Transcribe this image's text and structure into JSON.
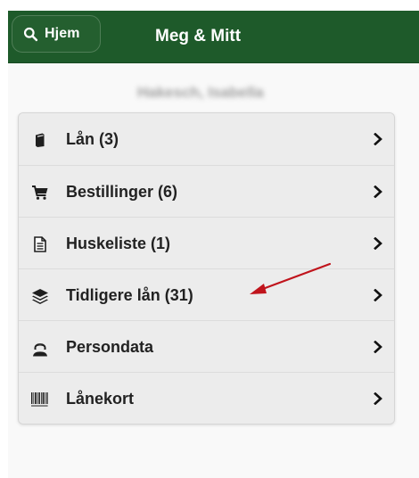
{
  "colors": {
    "header_bg": "#1e5a2a",
    "menu_bg": "#ececec",
    "annotation_arrow": "#c0141c"
  },
  "header": {
    "home_button_label": "Hjem",
    "home_button_icon": "search-icon",
    "title": "Meg & Mitt"
  },
  "patron": {
    "name": "Hakesch, Isabella"
  },
  "menu": {
    "items": [
      {
        "label": "Lån (3)",
        "icon": "book-icon"
      },
      {
        "label": "Bestillinger (6)",
        "icon": "cart-icon"
      },
      {
        "label": "Huskeliste (1)",
        "icon": "document-icon"
      },
      {
        "label": "Tidligere lån (31)",
        "icon": "layers-icon"
      },
      {
        "label": "Persondata",
        "icon": "user-icon"
      },
      {
        "label": "Lånekort",
        "icon": "barcode-icon"
      }
    ]
  },
  "annotation": {
    "icon": "arrow-icon"
  }
}
